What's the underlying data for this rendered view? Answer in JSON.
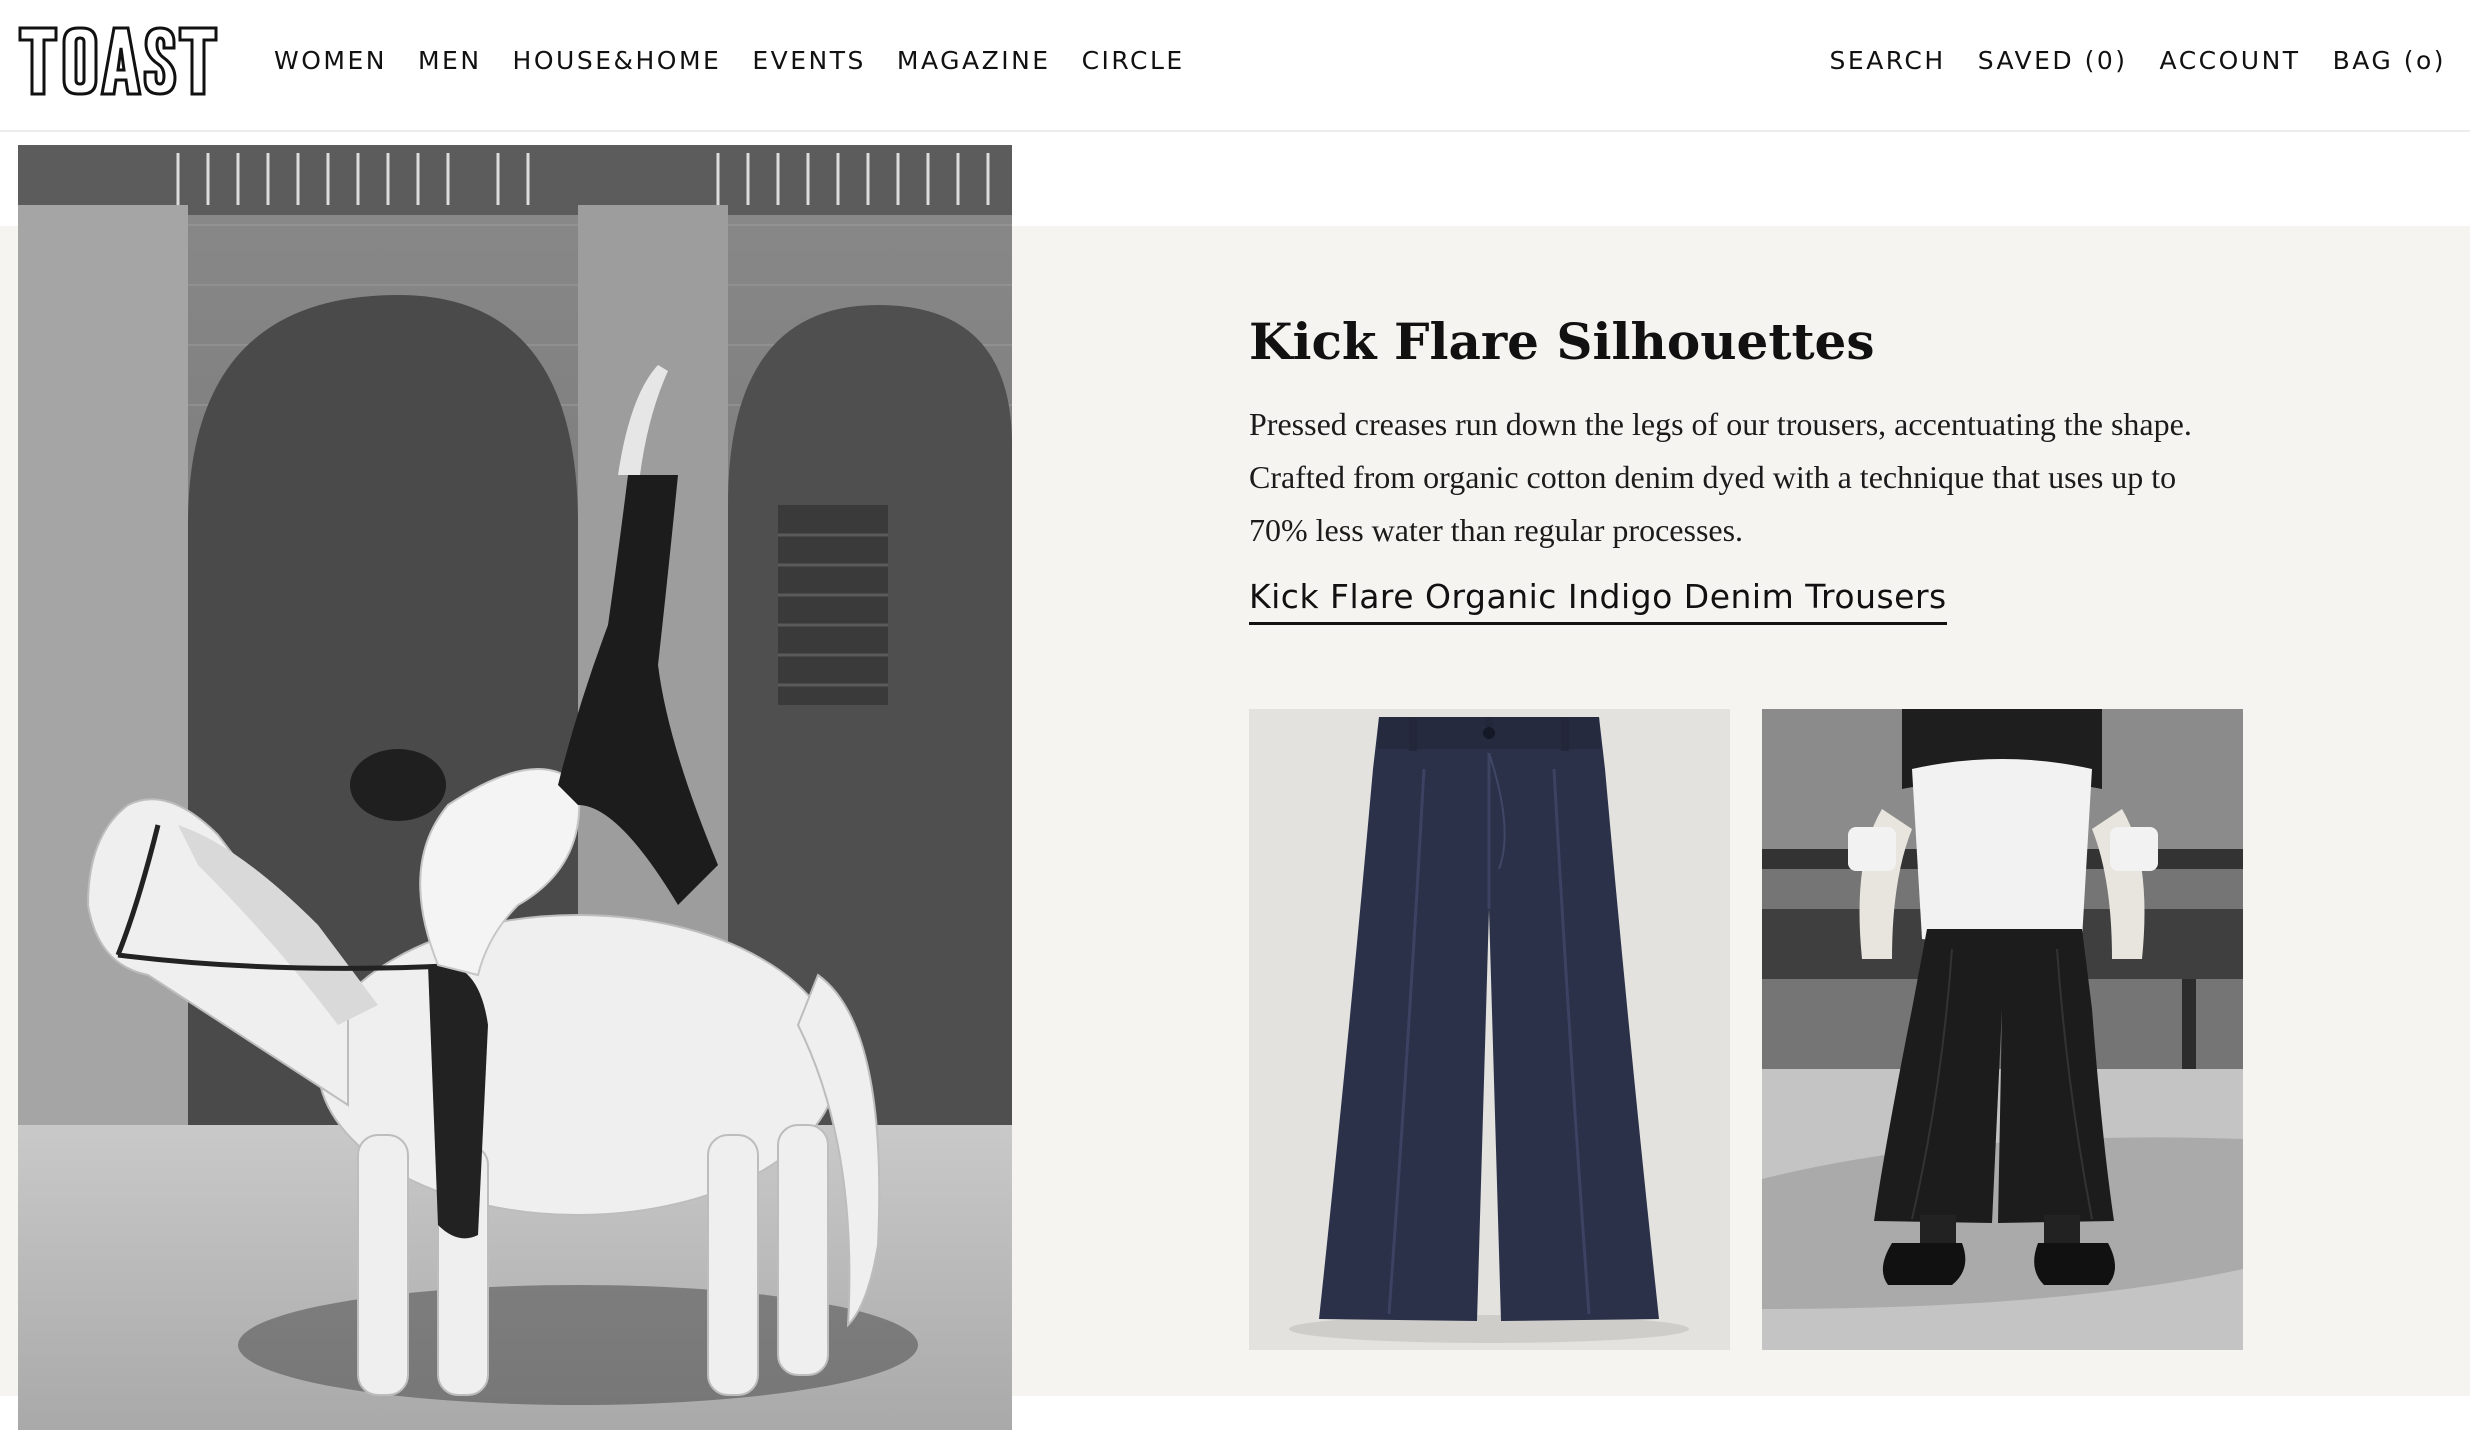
{
  "brand": {
    "logo_text": "TOAST"
  },
  "nav": {
    "items": [
      {
        "label": "WOMEN"
      },
      {
        "label": "MEN"
      },
      {
        "label": "HOUSE&HOME"
      },
      {
        "label": "EVENTS"
      },
      {
        "label": "MAGAZINE"
      },
      {
        "label": "CIRCLE"
      }
    ]
  },
  "utility": {
    "search": "SEARCH",
    "saved": "SAVED (0)",
    "account": "ACCOUNT",
    "bag": "BAG (o)"
  },
  "feature": {
    "title": "Kick Flare Silhouettes",
    "description": "Pressed creases run down the legs of our trousers, accentuating the shape. Crafted from organic cotton denim dyed with a technique that uses up to 70% less water than regular processes.",
    "product_link": "Kick Flare Organic Indigo Denim Trousers"
  },
  "colors": {
    "panel_background": "#f5f4f0",
    "text": "#111111",
    "denim": "#2b3149"
  },
  "images": {
    "hero": "hero-photo",
    "thumb_1": "product-photo",
    "thumb_2": "model-photo"
  }
}
